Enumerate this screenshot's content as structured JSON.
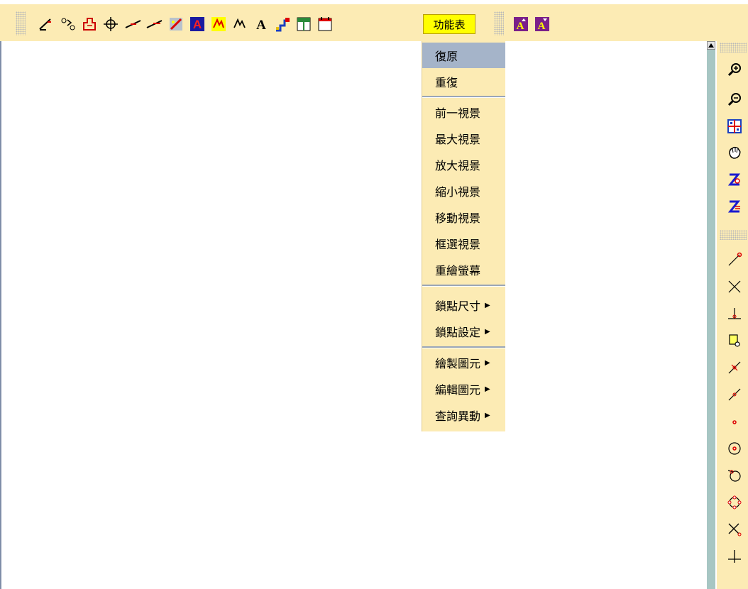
{
  "toolbar": {
    "icons": [
      "pencil-icon",
      "node-snap-icon",
      "stamp-icon",
      "move-cross-icon",
      "line-icon",
      "extend-line-icon",
      "image-icon",
      "text-a-red-icon",
      "text-tilde-red-icon",
      "text-tilde-black-icon",
      "text-a-black-icon",
      "step-icon",
      "window-icon",
      "calendar-icon"
    ],
    "menu_label": "功能表",
    "text_up_label": "A",
    "text_down_label": "A"
  },
  "menu": {
    "items": [
      {
        "label": "復原",
        "selected": true
      },
      {
        "label": "重復"
      },
      {
        "label": "前一視景"
      },
      {
        "label": "最大視景"
      },
      {
        "label": "放大視景"
      },
      {
        "label": "縮小視景"
      },
      {
        "label": "移動視景"
      },
      {
        "label": "框選視景"
      },
      {
        "label": "重繪螢幕"
      },
      {
        "label": "鎖點尺寸",
        "submenu": true
      },
      {
        "label": "鎖點設定",
        "submenu": true
      },
      {
        "label": "繪製圖元",
        "submenu": true
      },
      {
        "label": "編輯圖元",
        "submenu": true
      },
      {
        "label": "查詢異動",
        "submenu": true
      }
    ],
    "submenu_arrow": "▶"
  },
  "right_panel": {
    "view_icons": [
      "zoom-in-icon",
      "zoom-out-icon",
      "zoom-window-icon",
      "pan-hand-icon",
      "z-up-icon",
      "z-down-icon"
    ],
    "snap_icons": [
      "snap-endpoint-icon",
      "snap-intersection-icon",
      "snap-perpendicular-icon",
      "snap-box-icon",
      "snap-nearest-icon",
      "snap-midline-icon",
      "snap-point-icon",
      "snap-center-icon",
      "snap-tangent-icon",
      "snap-quadrant-icon",
      "snap-cross-icon",
      "snap-plus-icon"
    ]
  },
  "colors": {
    "toolbar_bg": "#fcebb4",
    "menu_highlight": "#a5b4c9",
    "scrollbar": "#a7c6c3",
    "accent_yellow": "#ffff00",
    "purple": "#7a1f8a"
  }
}
